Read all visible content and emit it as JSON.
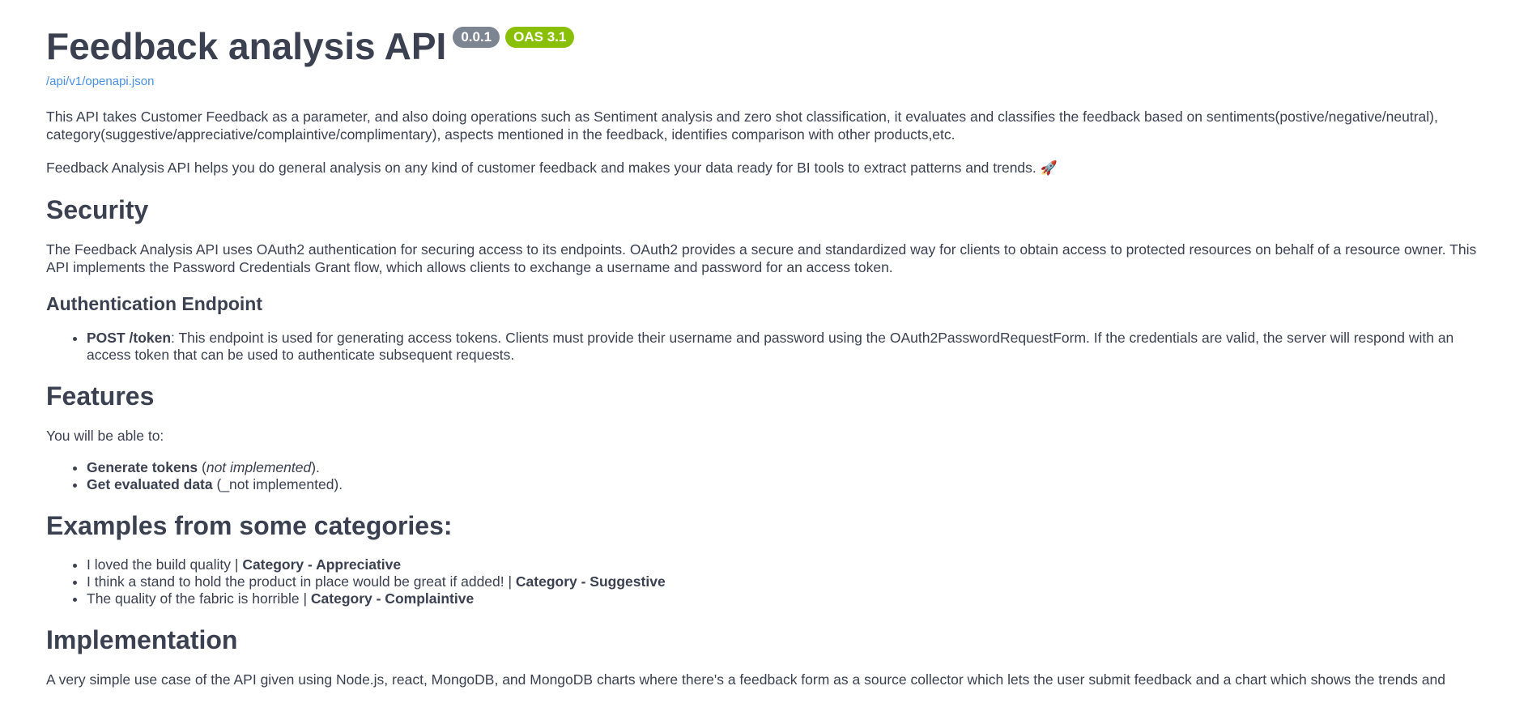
{
  "header": {
    "title": "Feedback analysis API",
    "version_badge": "0.0.1",
    "oas_badge": "OAS 3.1",
    "spec_link": "/api/v1/openapi.json"
  },
  "intro": {
    "paragraph1": "This API takes Customer Feedback as a parameter, and also doing operations such as Sentiment analysis and zero shot classification, it evaluates and classifies the feedback based on sentiments(postive/negative/neutral), category(suggestive/appreciative/complaintive/complimentary), aspects mentioned in the feedback, identifies comparison with other products,etc.",
    "paragraph2": "Feedback Analysis API helps you do general analysis on any kind of customer feedback and makes your data ready for BI tools to extract patterns and trends.",
    "rocket": "🚀"
  },
  "security": {
    "heading": "Security",
    "paragraph": "The Feedback Analysis API uses OAuth2 authentication for securing access to its endpoints. OAuth2 provides a secure and standardized way for clients to obtain access to protected resources on behalf of a resource owner. This API implements the Password Credentials Grant flow, which allows clients to exchange a username and password for an access token."
  },
  "auth": {
    "heading": "Authentication Endpoint",
    "endpoint": "POST /token",
    "description": ": This endpoint is used for generating access tokens. Clients must provide their username and password using the OAuth2PasswordRequestForm. If the credentials are valid, the server will respond with an access token that can be used to authenticate subsequent requests."
  },
  "features": {
    "heading": "Features",
    "intro": "You will be able to:",
    "items": [
      {
        "bold": "Generate tokens",
        "pre": " (",
        "italic": "not implemented",
        "post": ")."
      },
      {
        "bold": "Get evaluated data",
        "rest": " (_not implemented)."
      }
    ]
  },
  "examples": {
    "heading": "Examples from some categories:",
    "items": [
      {
        "text": "I loved the build quality | ",
        "category": "Category - Appreciative"
      },
      {
        "text": "I think a stand to hold the product in place would be great if added! | ",
        "category": "Category - Suggestive"
      },
      {
        "text": "The quality of the fabric is horrible | ",
        "category": "Category - Complaintive"
      }
    ]
  },
  "implementation": {
    "heading": "Implementation",
    "paragraph": "A very simple use case of the API given using Node.js, react, MongoDB, and MongoDB charts where there's a feedback form as a source collector which lets the user submit feedback and a chart which shows the trends and"
  }
}
